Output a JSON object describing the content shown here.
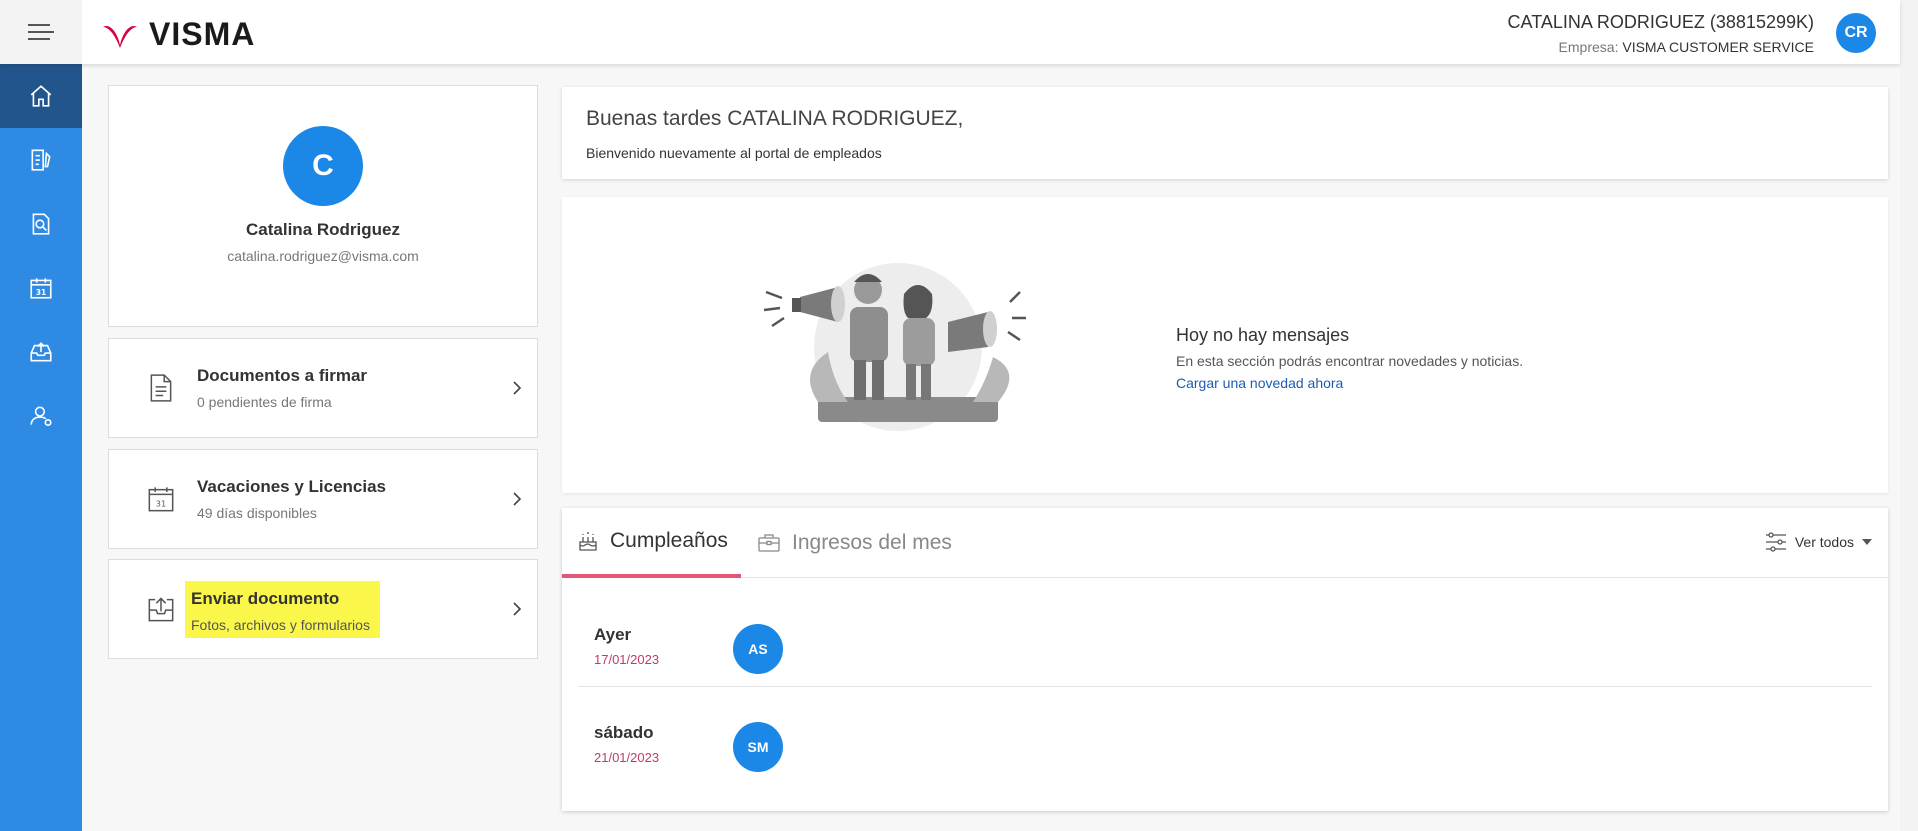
{
  "header": {
    "logo_text": "VISMA",
    "user_name": "CATALINA RODRIGUEZ (38815299K)",
    "company_label": "Empresa:",
    "company_name": "VISMA CUSTOMER SERVICE",
    "avatar_initials": "CR"
  },
  "sidebar": {
    "items": [
      {
        "name": "home-icon",
        "active": true
      },
      {
        "name": "documents-sign-icon",
        "active": false
      },
      {
        "name": "document-search-icon",
        "active": false
      },
      {
        "name": "calendar-icon",
        "active": false
      },
      {
        "name": "inbox-upload-icon",
        "active": false
      },
      {
        "name": "user-settings-icon",
        "active": false
      }
    ]
  },
  "profile": {
    "initial": "C",
    "name": "Catalina Rodriguez",
    "email": "catalina.rodriguez@visma.com"
  },
  "actions": [
    {
      "title": "Documentos a firmar",
      "subtitle": "0 pendientes de firma",
      "icon": "document-icon"
    },
    {
      "title": "Vacaciones y Licencias",
      "subtitle": "49 días disponibles",
      "icon": "calendar-icon"
    },
    {
      "title": "Enviar documento",
      "subtitle": "Fotos, archivos y formularios",
      "icon": "upload-tray-icon"
    }
  ],
  "welcome": {
    "greeting": "Buenas tardes CATALINA RODRIGUEZ,",
    "subtitle": "Bienvenido nuevamente al portal de empleados"
  },
  "messages": {
    "title": "Hoy no hay mensajes",
    "subtitle": "En esta sección podrás encontrar novedades y noticias.",
    "link": "Cargar una novedad ahora"
  },
  "birthdays": {
    "tabs": [
      {
        "label": "Cumpleaños",
        "icon": "cake-icon",
        "active": true
      },
      {
        "label": "Ingresos del mes",
        "icon": "briefcase-icon",
        "active": false
      }
    ],
    "view_all": "Ver todos",
    "rows": [
      {
        "day": "Ayer",
        "date": "17/01/2023",
        "initials": "AS"
      },
      {
        "day": "sábado",
        "date": "21/01/2023",
        "initials": "SM"
      }
    ]
  },
  "colors": {
    "sidebar": "#2e8ae3",
    "sidebar_active": "#22558b",
    "avatar": "#1b87e6",
    "accent": "#e0577a",
    "highlight": "#fbf74a",
    "logo_red": "#d7003f"
  }
}
